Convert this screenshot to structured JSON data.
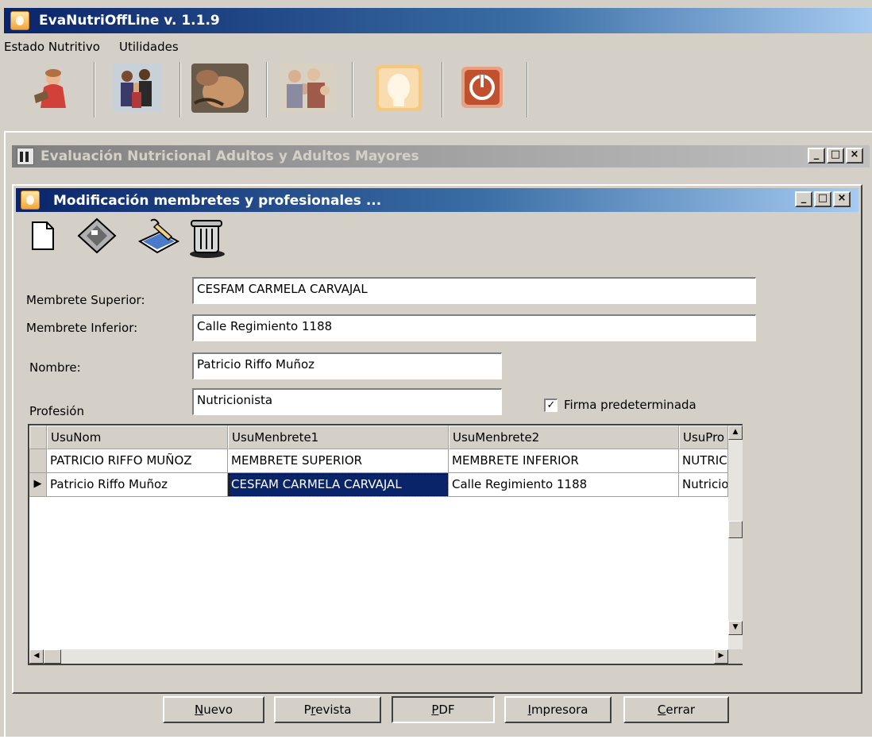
{
  "app": {
    "title": "EvaNutriOffLine  v. 1.1.9",
    "menu": [
      "Estado Nutritivo",
      "Utilidades"
    ],
    "toolbar_icons": [
      "child-icon",
      "family-icon",
      "pregnancy-icon",
      "elderly-icon",
      "head-profile-icon",
      "power-icon"
    ]
  },
  "mdi": {
    "title": "Evaluación Nutricional Adultos y Adultos Mayores"
  },
  "dialog": {
    "title": "Modificación membretes y profesionales ...",
    "tool_icons": [
      "new-document-icon",
      "save-disk-icon",
      "edit-pencil-icon",
      "trash-icon"
    ],
    "form": {
      "membrete_superior_label": "Membrete Superior:",
      "membrete_superior_value": "CESFAM CARMELA CARVAJAL",
      "membrete_inferior_label": "Membrete Inferior:",
      "membrete_inferior_value": "Calle Regimiento 1188",
      "nombre_label": "Nombre:",
      "nombre_value": "Patricio Riffo Muñoz",
      "profesion_label": "Profesión",
      "profesion_value": "Nutricionista",
      "firma_label": "Firma predeterminada",
      "firma_checked": true
    },
    "grid": {
      "columns": [
        "UsuNom",
        "UsuMenbrete1",
        "UsuMenbrete2",
        "UsuPro"
      ],
      "rows": [
        [
          "PATRICIO RIFFO MUÑOZ",
          "MEMBRETE SUPERIOR",
          "MEMBRETE INFERIOR",
          "NUTRIC"
        ],
        [
          "Patricio Riffo Muñoz",
          "CESFAM CARMELA CARVAJAL",
          "Calle Regimiento 1188",
          "Nutricio"
        ]
      ]
    },
    "buttons": {
      "nuevo_u": "N",
      "nuevo_rest": "uevo",
      "prevista_pre": "P",
      "prevista_u": "r",
      "prevista_rest": "evista",
      "pdf_pre": "",
      "pdf_u": "P",
      "pdf_rest": "DF",
      "impresora_u": "I",
      "impresora_rest": "mpresora",
      "cerrar_u": "C",
      "cerrar_rest": "errar"
    }
  },
  "colors": {
    "active_title": "#0a246a",
    "inactive_title": "#808080",
    "face": "#d4d0c8",
    "selection": "#0a246a"
  }
}
